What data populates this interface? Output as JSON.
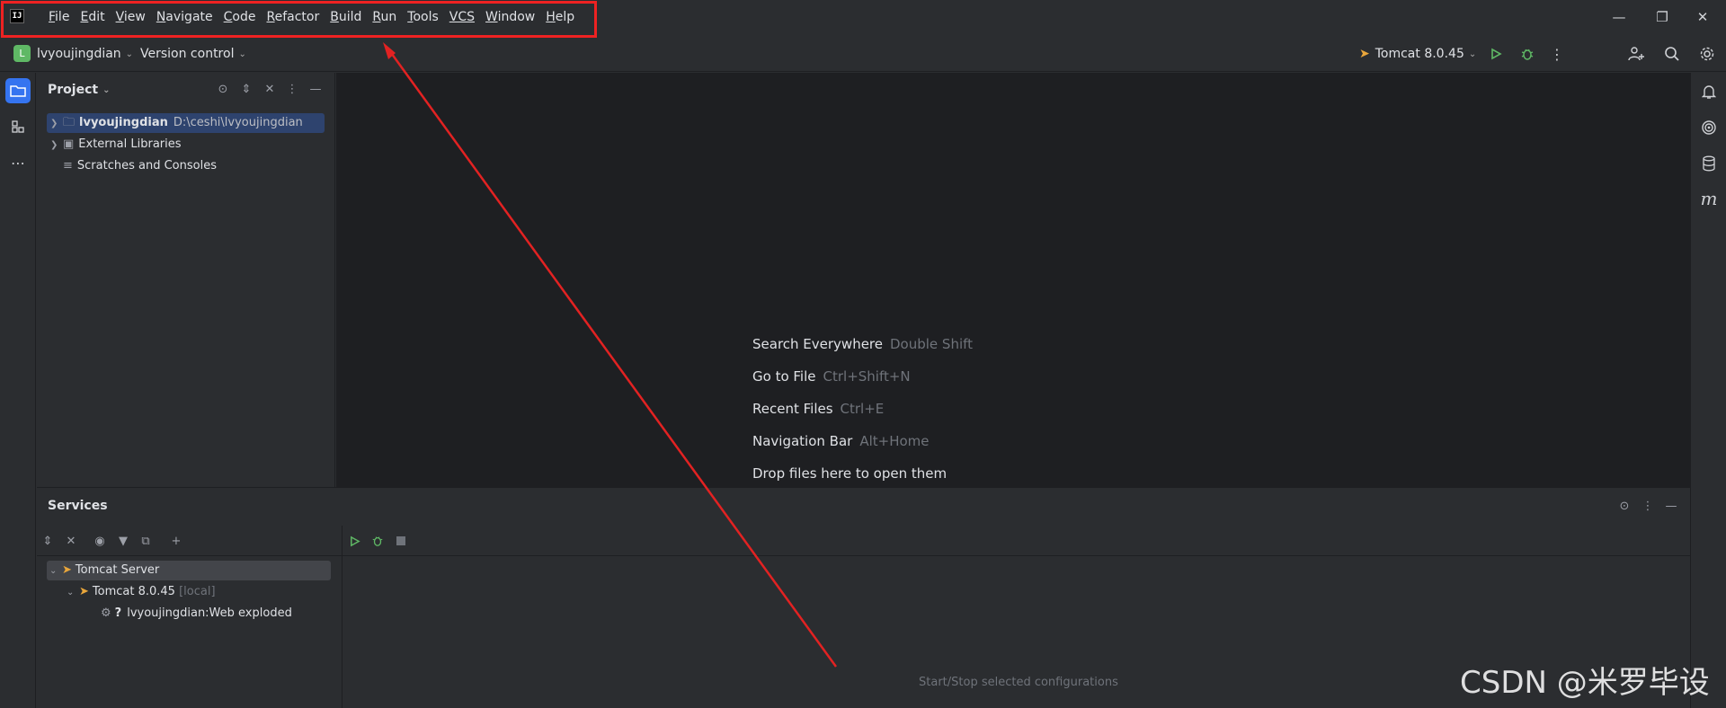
{
  "menubar": {
    "logo_text": "IJ",
    "items": [
      {
        "u": "F",
        "rest": "ile"
      },
      {
        "u": "E",
        "rest": "dit"
      },
      {
        "u": "V",
        "rest": "iew"
      },
      {
        "u": "N",
        "rest": "avigate"
      },
      {
        "u": "C",
        "rest": "ode"
      },
      {
        "u": "R",
        "rest": "efactor"
      },
      {
        "u": "B",
        "rest": "uild"
      },
      {
        "u": "R",
        "rest": "un",
        "pre": ""
      },
      {
        "u": "T",
        "rest": "ools"
      },
      {
        "u": "VCS",
        "rest": ""
      },
      {
        "u": "W",
        "rest": "indow"
      },
      {
        "u": "H",
        "rest": "elp"
      }
    ]
  },
  "toolbar": {
    "project_initial": "L",
    "project_name": "lvyoujingdian",
    "vcs_label": "Version control",
    "run_config": "Tomcat 8.0.45"
  },
  "project": {
    "title": "Project",
    "items": [
      {
        "name": "lvyoujingdian",
        "path": "D:\\ceshi\\lvyoujingdian"
      },
      {
        "name": "External Libraries"
      },
      {
        "name": "Scratches and Consoles"
      }
    ]
  },
  "editor": {
    "hints": [
      {
        "label": "Search Everywhere",
        "shortcut": "Double Shift"
      },
      {
        "label": "Go to File",
        "shortcut": "Ctrl+Shift+N"
      },
      {
        "label": "Recent Files",
        "shortcut": "Ctrl+E"
      },
      {
        "label": "Navigation Bar",
        "shortcut": "Alt+Home"
      },
      {
        "label": "Drop files here to open them",
        "shortcut": ""
      }
    ]
  },
  "services": {
    "title": "Services",
    "tree": [
      {
        "label": "Tomcat Server"
      },
      {
        "label": "Tomcat 8.0.45",
        "suffix": "[local]"
      },
      {
        "label": "lvyoujingdian:Web exploded"
      }
    ],
    "empty_text": "Start/Stop selected configurations"
  },
  "watermark": "CSDN @米罗毕设",
  "colors": {
    "annotation": "#e22222",
    "run_green": "#5fb865",
    "selection": "#2e436e"
  }
}
